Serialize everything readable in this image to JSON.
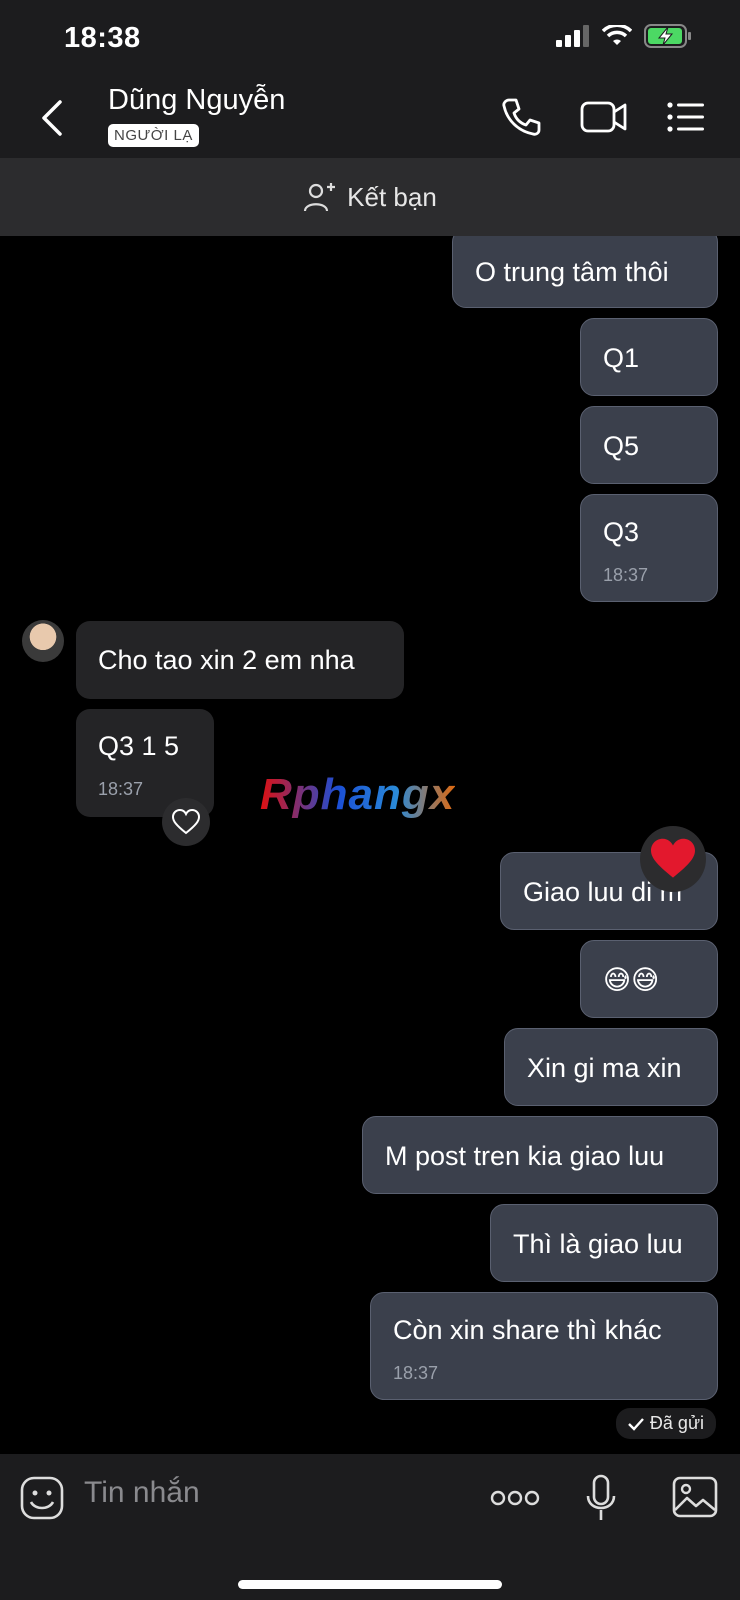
{
  "status": {
    "time": "18:38"
  },
  "header": {
    "name": "Dũng Nguyễn",
    "badge": "NGƯỜI LẠ"
  },
  "friend_bar": {
    "label": "Kết bạn"
  },
  "messages": [
    {
      "text": "O trung tâm thôi",
      "dir": "out"
    },
    {
      "text": "Q1",
      "dir": "out"
    },
    {
      "text": "Q5",
      "dir": "out"
    },
    {
      "text": "Q3",
      "dir": "out",
      "time": "18:37"
    },
    {
      "text": "Cho tao xin 2 em nha",
      "dir": "in"
    },
    {
      "text": "Q3 1 5",
      "dir": "in",
      "time": "18:37"
    },
    {
      "text": "Giao luu di m",
      "dir": "out"
    },
    {
      "text": "😅😅",
      "dir": "out"
    },
    {
      "text": "Xin gi ma xin",
      "dir": "out"
    },
    {
      "text": "M post tren kia giao luu",
      "dir": "out"
    },
    {
      "text": "Thì là giao luu",
      "dir": "out"
    },
    {
      "text": "Còn xin share thì khác",
      "dir": "out",
      "time": "18:37"
    }
  ],
  "watermark": "Rphangx",
  "sent_status": "Đã gửi",
  "input": {
    "placeholder": "Tin nhắn"
  },
  "colors": {
    "bubble_out": "#3b404c",
    "bubble_in": "#242426",
    "header_bg": "#1c1c1e"
  }
}
